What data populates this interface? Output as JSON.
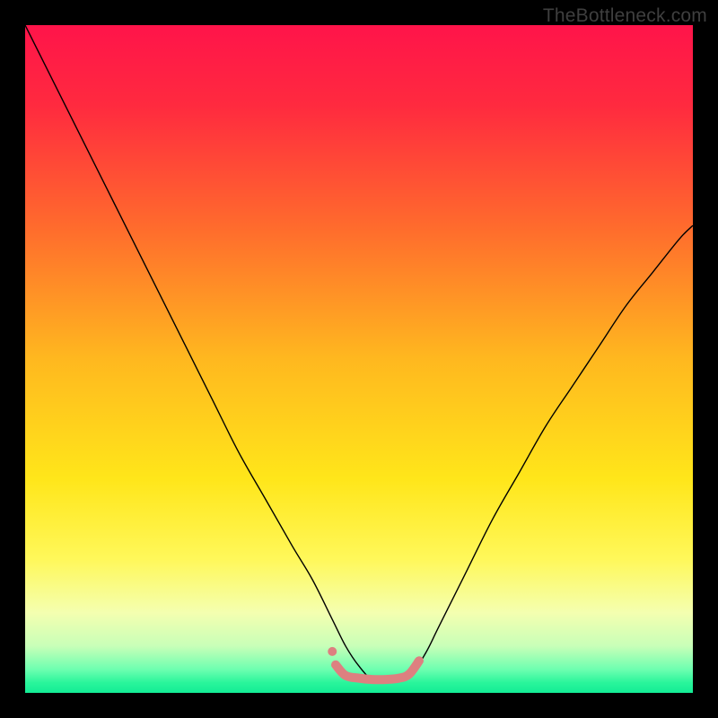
{
  "watermark": "TheBottleneck.com",
  "chart_data": {
    "type": "line",
    "title": "",
    "xlabel": "",
    "ylabel": "",
    "xlim": [
      0,
      100
    ],
    "ylim": [
      0,
      100
    ],
    "gradient_stops": [
      {
        "offset": 0.0,
        "color": "#ff144a"
      },
      {
        "offset": 0.12,
        "color": "#ff2a3f"
      },
      {
        "offset": 0.3,
        "color": "#ff6a2d"
      },
      {
        "offset": 0.5,
        "color": "#ffb81f"
      },
      {
        "offset": 0.68,
        "color": "#ffe61a"
      },
      {
        "offset": 0.8,
        "color": "#fff85a"
      },
      {
        "offset": 0.88,
        "color": "#f4ffb0"
      },
      {
        "offset": 0.93,
        "color": "#c8ffb8"
      },
      {
        "offset": 0.965,
        "color": "#6dffb0"
      },
      {
        "offset": 0.985,
        "color": "#29f59b"
      },
      {
        "offset": 1.0,
        "color": "#13ec95"
      }
    ],
    "series": [
      {
        "name": "bottleneck-curve",
        "stroke": "#000000",
        "stroke_width": 1.4,
        "x": [
          0,
          4,
          8,
          12,
          16,
          20,
          24,
          28,
          32,
          36,
          40,
          43,
          46,
          48,
          50,
          52,
          54,
          56,
          58,
          60,
          62,
          66,
          70,
          74,
          78,
          82,
          86,
          90,
          94,
          98,
          100
        ],
        "values": [
          100,
          92,
          84,
          76,
          68,
          60,
          52,
          44,
          36,
          29,
          22,
          17,
          11,
          7,
          4,
          2,
          2,
          2,
          3,
          6,
          10,
          18,
          26,
          33,
          40,
          46,
          52,
          58,
          63,
          68,
          70
        ]
      },
      {
        "name": "optimal-range-marker",
        "stroke": "#dd8080",
        "stroke_width": 10,
        "linecap": "round",
        "x": [
          46.5,
          48,
          50,
          52,
          54,
          56,
          57.5,
          59
        ],
        "values": [
          4.2,
          2.6,
          2.2,
          2.0,
          2.0,
          2.2,
          2.8,
          4.8
        ]
      }
    ],
    "marker_dot": {
      "x": 46,
      "y": 6.2,
      "r": 5,
      "fill": "#dd8080"
    }
  }
}
